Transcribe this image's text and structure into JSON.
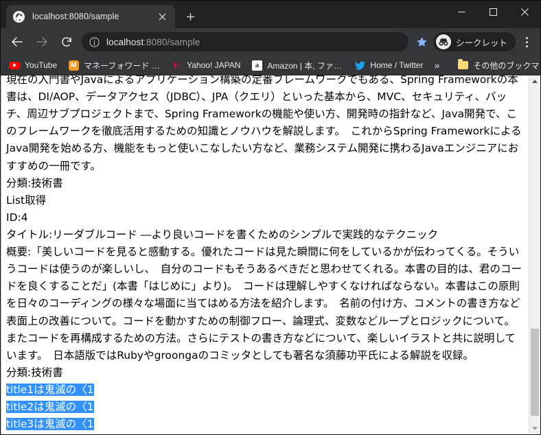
{
  "window": {
    "controls": {
      "minimize_label": "—",
      "maximize_label": "□",
      "close_label": "✕"
    }
  },
  "tabstrip": {
    "tabs": [
      {
        "title": "localhost:8080/sample",
        "favicon": "globe-icon",
        "close_label": "✕"
      }
    ],
    "new_tab_label": "+"
  },
  "toolbar": {
    "back_label": "←",
    "forward_label": "→",
    "reload_label": "⟳",
    "info_label": "ⓘ",
    "url_scheme_host": "localhost",
    "url_rest": ":8080/sample",
    "bookmark_star_label": "★",
    "incognito_label": "シークレット",
    "menu_label": "⋮"
  },
  "bookmarks_bar": {
    "items": [
      {
        "label": "YouTube",
        "icon": "youtube-icon"
      },
      {
        "label": "マネーフォワード ME",
        "icon": "moneyforward-icon"
      },
      {
        "label": "Yahoo! JAPAN",
        "icon": "yahoo-icon"
      },
      {
        "label": "Amazon | 本, ファッシ...",
        "icon": "amazon-icon"
      },
      {
        "label": "Home / Twitter",
        "icon": "twitter-icon"
      }
    ],
    "overflow_label": "»",
    "other_bookmarks_label": "その他のブックマーク",
    "other_bookmarks_icon": "folder-icon"
  },
  "page": {
    "lines": [
      {
        "text": "現在の入門書やJavaによるアプリケーション構築の定番フレームワークでもある、Spring Frameworkの本",
        "selected": false
      },
      {
        "text": "書は、DI/AOP、データアクセス（JDBC）、JPA（クエリ）といった基本から、MVC、セキュリティ、バッチ、周辺サブプロジェクトまで、Spring Frameworkの機能や使い方、開発時の指針など、Java開発で、このフレームワークを徹底活用するための知識とノウハウを解説します。　これからSpring FrameworkによるJava開発を始める方、機能をもっと使いこなしたい方など、業務システム開発に携わるJavaエンジニアにおすすめの一冊です。",
        "selected": false
      },
      {
        "text": "分類:技術書",
        "selected": false
      },
      {
        "text": "List取得",
        "selected": false
      },
      {
        "text": "ID:4",
        "selected": false
      },
      {
        "text": "タイトル:リーダブルコード ―より良いコードを書くためのシンプルで実践的なテクニック",
        "selected": false
      },
      {
        "text": "概要:「美しいコードを見ると感動する。優れたコードは見た瞬間に何をしているかが伝わってくる。そういうコードは使うのが楽しいし、　自分のコードもそうあるべきだと思わせてくれる。本書の目的は、君のコードを良くすることだ」(本書「はじめに」より)。　コードは理解しやすくなければならない。本書はこの原則を日々のコーディングの様々な場面に当てはめる方法を紹介します。　名前の付け方、コメントの書き方など表面上の改善について。コードを動かすための制御フロー、論理式、変数などループとロジックについて。　またコードを再構成するための方法。さらにテストの書き方などについて、楽しいイラストと共に説明しています。　日本語版ではRubyやgroongaのコミッタとしても著名な須藤功平氏による解説を収録。",
        "selected": false
      },
      {
        "text": "分類:技術書",
        "selected": false
      },
      {
        "text": "title1は鬼滅の〈1",
        "selected": true
      },
      {
        "text": "title2は鬼滅の〈1",
        "selected": true
      },
      {
        "text": "title3は鬼滅の〈1",
        "selected": true
      }
    ],
    "selection_color": "#3390ff"
  },
  "scrollbar": {
    "up_label": "▲",
    "down_label": "▼",
    "thumb_top_pct": 72,
    "thumb_height_pct": 26
  }
}
